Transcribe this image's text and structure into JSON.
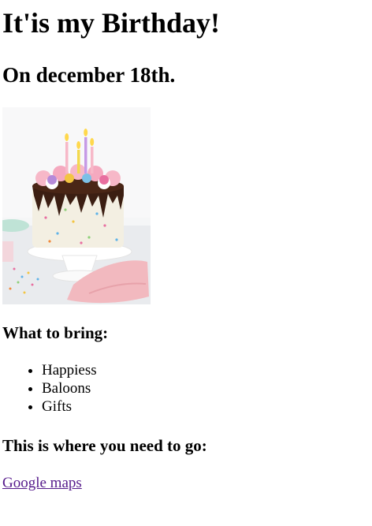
{
  "heading": "It'is my Birthday!",
  "subheading": "On december 18th.",
  "image": {
    "icon": "birthday-cake-image",
    "colors": {
      "frosting": "#f7b8c8",
      "drip": "#3b1e12",
      "cake": "#f3efe2",
      "stand": "#ffffff",
      "napkin": "#f2b9bf",
      "background": "#f1f3f4"
    }
  },
  "bring": {
    "title": "What to bring:",
    "items": [
      "Happiess",
      "Baloons",
      "Gifts"
    ]
  },
  "location": {
    "title": "This is where you need to go:",
    "link_label": "Google maps",
    "link_color": "#551a8b"
  }
}
